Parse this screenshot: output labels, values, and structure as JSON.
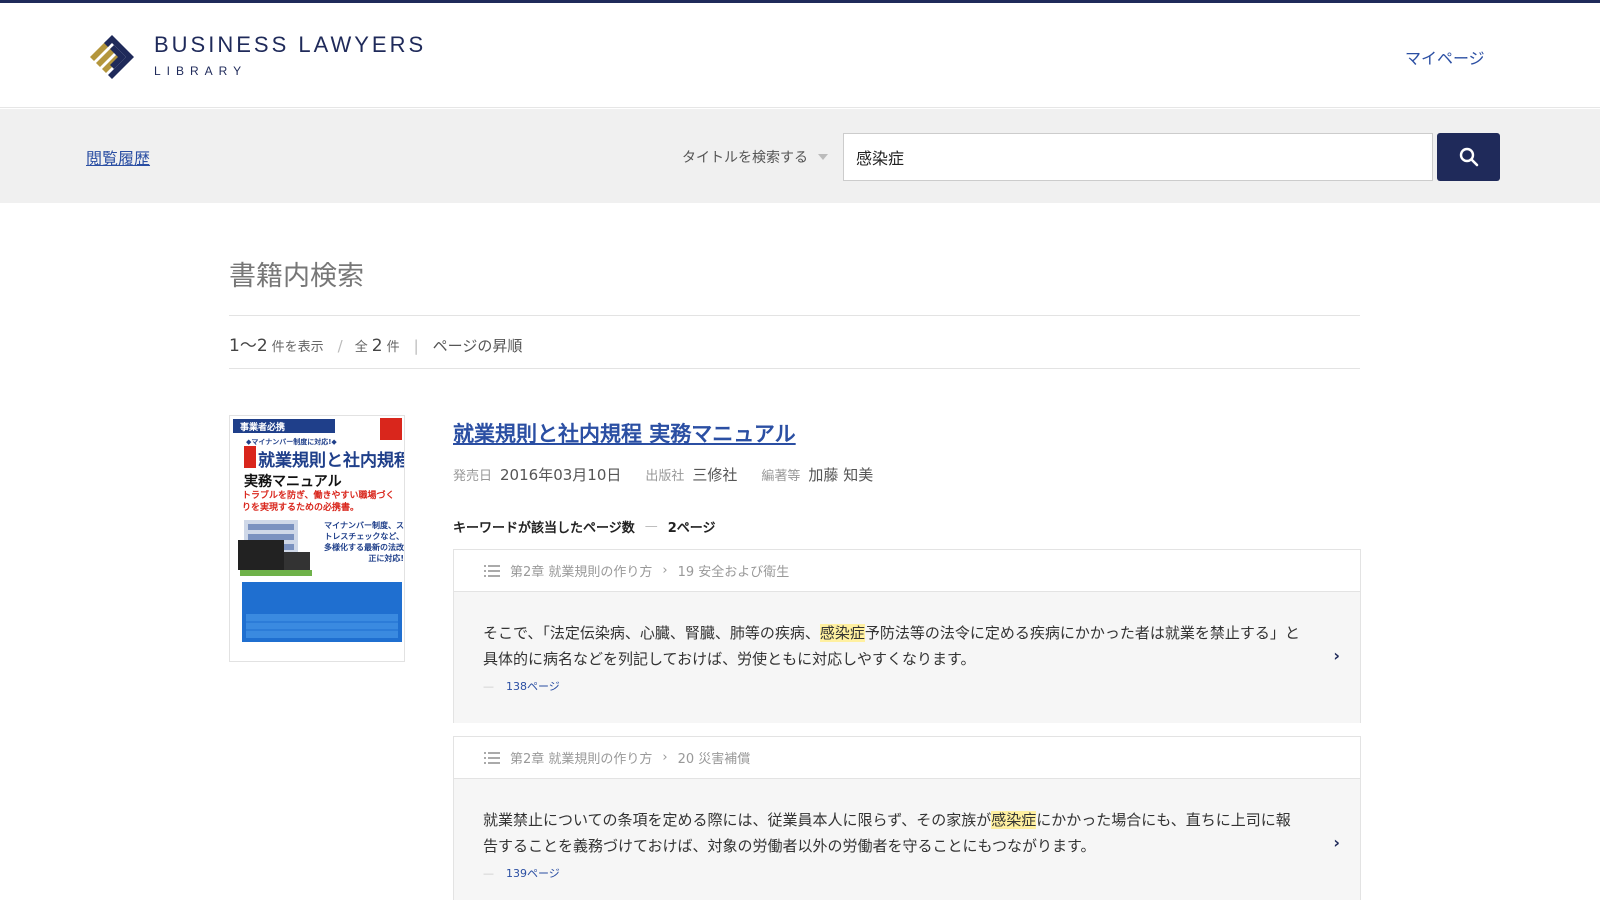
{
  "header": {
    "logo_title": "BUSINESS LAWYERS",
    "logo_sub": "LIBRARY",
    "mypage_label": "マイページ"
  },
  "searchbar": {
    "history_label": "閲覧履歴",
    "scope_label": "タイトルを検索する",
    "query": "感染症",
    "search_icon": "search-icon"
  },
  "main": {
    "page_title": "書籍内検索",
    "summary": {
      "range_main": "1〜2",
      "range_suffix": "件を表示",
      "total_prefix": "全",
      "total_count": "2",
      "total_suffix": "件",
      "order_label": "ページの昇順"
    }
  },
  "result": {
    "cover_lines": {
      "tag": "事業者必携",
      "sub": "◆マイナンバー制度に対応!◆",
      "title1": "就業規則と社内規程",
      "title2": "実務マニュアル",
      "lead": "トラブルを防ぎ、働きやすい職場づくりを実現するための必携書。",
      "side": "マイナンバー制度、ストレスチェックなど、多様化する最新の法改正に対応!"
    },
    "title": "就業規則と社内規程 実務マニュアル",
    "meta": [
      {
        "label": "発売日",
        "value": "2016年03月10日"
      },
      {
        "label": "出版社",
        "value": "三修社"
      },
      {
        "label": "編著等",
        "value": "加藤 知美"
      }
    ],
    "kw_label": "キーワードが該当したページ数",
    "kw_count": "2ページ",
    "hits": [
      {
        "chapter": "第2章 就業規則の作り方",
        "section": "19 安全および衛生",
        "text_before": "そこで、「法定伝染病、心臓、腎臓、肺等の疾病、",
        "highlight": "感染症",
        "text_after": "予防法等の法令に定める疾病にかかった者は就業を禁止する」と具体的に病名などを列記しておけば、労使ともに対応しやすくなります。",
        "page": "138ページ"
      },
      {
        "chapter": "第2章 就業規則の作り方",
        "section": "20 災害補償",
        "text_before": "就業禁止についての条項を定める際には、従業員本人に限らず、その家族が",
        "highlight": "感染症",
        "text_after": "にかかった場合にも、直ちに上司に報告することを義務づけておけば、対象の労働者以外の労働者を守ることにもつながります。",
        "page": "139ページ"
      }
    ]
  }
}
